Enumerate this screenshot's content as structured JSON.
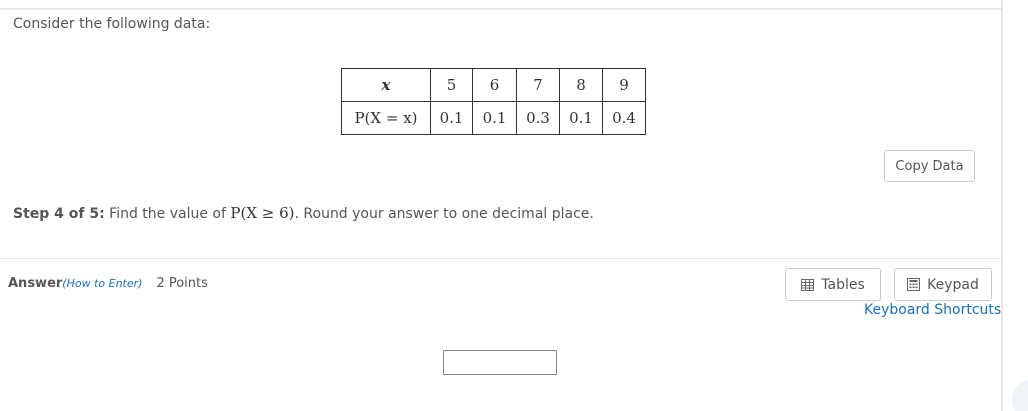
{
  "question": {
    "intro": "Consider the following data:",
    "table": {
      "row1_header": "x",
      "row2_header": "P(X = x)",
      "x_values": [
        "5",
        "6",
        "7",
        "8",
        "9"
      ],
      "p_values": [
        "0.1",
        "0.1",
        "0.3",
        "0.1",
        "0.4"
      ]
    },
    "copy_data_label": "Copy Data",
    "step_prefix": "Step 4 of 5:",
    "step_text_before": " Find the value of ",
    "step_math": "P(X ≥ 6)",
    "step_text_after": ". Round your answer to one decimal place."
  },
  "answer": {
    "label": "Answer",
    "how_to_enter": "(How to Enter)",
    "points": "2 Points",
    "input_value": ""
  },
  "tools": {
    "tables_label": "Tables",
    "keypad_label": "Keypad",
    "keyboard_shortcuts_label": "Keyboard Shortcuts"
  },
  "icons": {
    "tables": "table-grid-icon",
    "keypad": "keypad-icon"
  },
  "colors": {
    "link": "#1a6fb5",
    "border": "#cccccc",
    "text": "#555555"
  }
}
